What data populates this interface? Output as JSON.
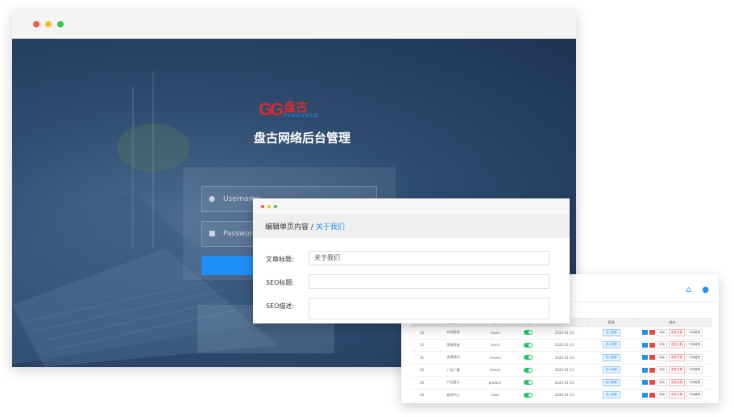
{
  "login": {
    "window_controls": [
      "close",
      "minimize",
      "maximize"
    ],
    "logo": {
      "mark": "GG",
      "cn": "盘古",
      "en": "PANGUWEB"
    },
    "title": "盘古网络后台管理",
    "username_placeholder": "Username",
    "password_placeholder": "Password",
    "button_label": "",
    "colors": {
      "accent": "#1e90f5",
      "logo_red": "#d62d2d",
      "background": "#2f4b70"
    }
  },
  "edit": {
    "breadcrumb_main": "编辑单页内容 /",
    "breadcrumb_link": "关于我们",
    "fields": [
      {
        "label": "文章标题:",
        "value": "关于我们"
      },
      {
        "label": "SEO标题:",
        "value": ""
      },
      {
        "label": "SEO描述:",
        "value": ""
      }
    ]
  },
  "table": {
    "icons": [
      "home-icon",
      "user-icon"
    ],
    "columns": [
      "ID",
      "栏目名称",
      "英文",
      "状态",
      "时间",
      "管理",
      "操作"
    ],
    "rows": [
      {
        "id": "33",
        "name": "在线案例",
        "en": "Cases",
        "date": "2022-01-13",
        "manage": "进入管理"
      },
      {
        "id": "32",
        "name": "荣誉荣誉",
        "en": "honor",
        "date": "2022-01-13",
        "manage": "进入管理"
      },
      {
        "id": "31",
        "name": "选择我们",
        "en": "choose",
        "date": "2022-01-13",
        "manage": "进入管理"
      },
      {
        "id": "30",
        "name": "广告广播",
        "en": "device",
        "date": "2022-01-13",
        "manage": "进入管理"
      },
      {
        "id": "29",
        "name": "产品展示",
        "en": "product",
        "date": "2022-01-13",
        "manage": "进入管理"
      },
      {
        "id": "28",
        "name": "新闻中心",
        "en": "news",
        "date": "2022-01-13",
        "manage": "进入管理"
      }
    ],
    "actions": {
      "edit": "改",
      "delete": "删",
      "add": "添加",
      "attr": "属性设置",
      "seo": "字段管理"
    }
  }
}
